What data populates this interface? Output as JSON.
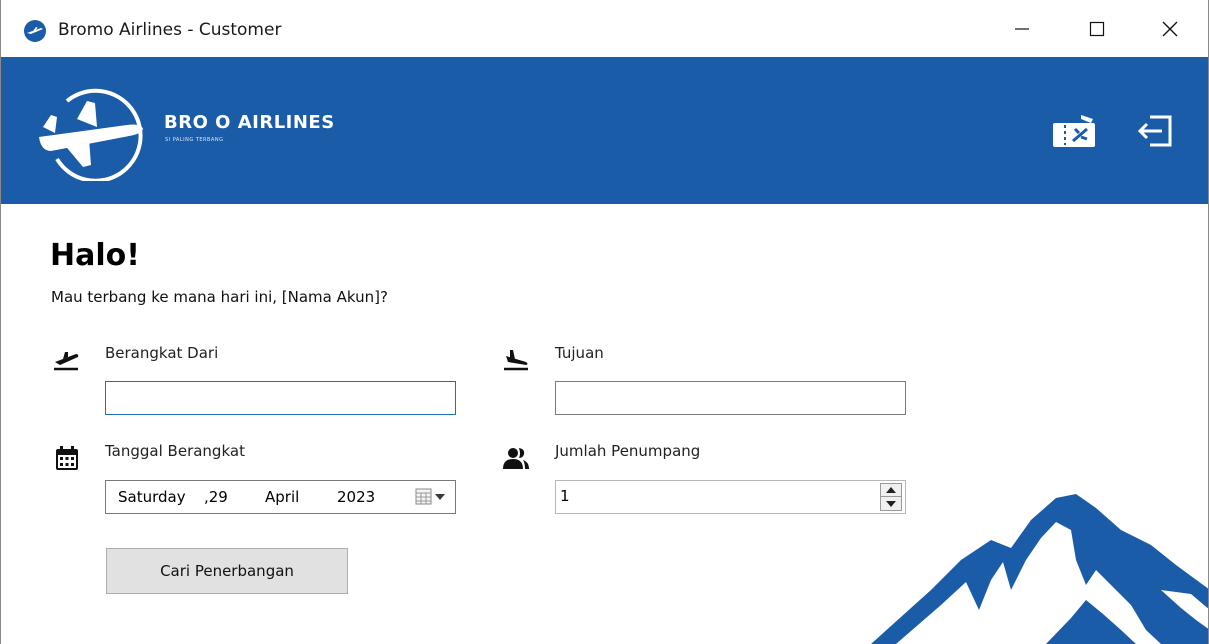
{
  "window": {
    "title": "Bromo Airlines - Customer"
  },
  "header": {
    "brand_name": "BRO O AIRLINES",
    "brand_tagline": "SI PALING TERBANG",
    "icons": [
      "ticket-icon",
      "logout-icon"
    ],
    "background_color": "#1a5ca8"
  },
  "greeting": {
    "title": "Halo!",
    "subtitle": "Mau terbang ke mana hari ini, [Nama Akun]?"
  },
  "form": {
    "from": {
      "label": "Berangkat Dari",
      "value": ""
    },
    "to": {
      "label": "Tujuan",
      "value": ""
    },
    "date": {
      "label": "Tanggal Berangkat",
      "weekday": "Saturday",
      "day": ",29",
      "month": "April",
      "year": "2023"
    },
    "passengers": {
      "label": "Jumlah Penumpang",
      "value": "1"
    },
    "search_button": "Cari Penerbangan"
  }
}
